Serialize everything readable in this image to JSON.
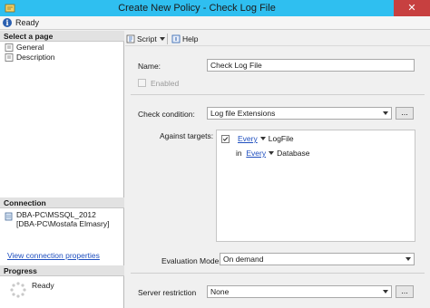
{
  "window": {
    "title": "Create New Policy - Check Log File",
    "close_glyph": "✕"
  },
  "status": {
    "text": "Ready",
    "info_glyph": "i"
  },
  "left_pane": {
    "select_page_header": "Select a page",
    "pages": [
      {
        "label": "General"
      },
      {
        "label": "Description"
      }
    ],
    "connection_header": "Connection",
    "connection_lines": [
      "DBA-PC\\MSSQL_2012",
      "[DBA-PC\\Mostafa Elmasry]"
    ],
    "view_connection_link": "View connection properties",
    "progress_header": "Progress",
    "progress_status": "Ready"
  },
  "toolbar": {
    "script_label": "Script",
    "help_label": "Help"
  },
  "form": {
    "name_label": "Name:",
    "name_value": "Check Log File",
    "enabled_label": "Enabled",
    "check_condition_label": "Check condition:",
    "check_condition_value": "Log file Extensions",
    "ellipsis": "...",
    "against_targets_label": "Against targets:",
    "target_row1": {
      "every": "Every",
      "object": "LogFile"
    },
    "target_row2": {
      "in": "in",
      "every": "Every",
      "object": "Database"
    },
    "evaluation_mode_label": "Evaluation Mode:",
    "evaluation_mode_value": "On demand",
    "server_restriction_label": "Server restriction",
    "server_restriction_value": "None"
  },
  "colors": {
    "titlebar": "#2fbff0",
    "close_button": "#c74040",
    "link": "#1f4fbf"
  }
}
